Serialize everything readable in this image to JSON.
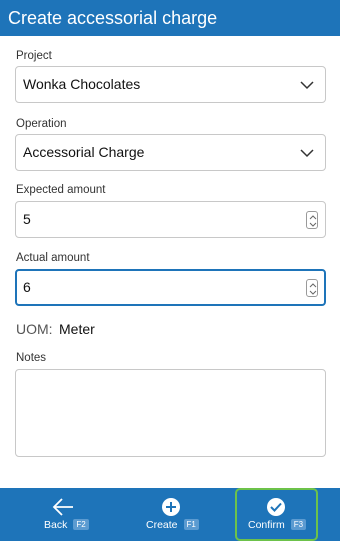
{
  "window": {
    "title": "Create accessorial charge"
  },
  "form": {
    "project": {
      "label": "Project",
      "value": "Wonka Chocolates"
    },
    "operation": {
      "label": "Operation",
      "value": "Accessorial Charge"
    },
    "expected_amount": {
      "label": "Expected amount",
      "value": "5"
    },
    "actual_amount": {
      "label": "Actual amount",
      "value": "6"
    },
    "uom": {
      "label": "UOM:",
      "value": "Meter"
    },
    "notes": {
      "label": "Notes",
      "value": ""
    }
  },
  "actions": {
    "back": {
      "label": "Back",
      "key": "F2",
      "icon": "arrow-left-icon"
    },
    "create": {
      "label": "Create",
      "key": "F1",
      "icon": "plus-circle-icon"
    },
    "confirm": {
      "label": "Confirm",
      "key": "F3",
      "icon": "check-circle-icon"
    }
  },
  "colors": {
    "accent": "#1e74b9",
    "confirm_highlight": "#6cc24a"
  }
}
